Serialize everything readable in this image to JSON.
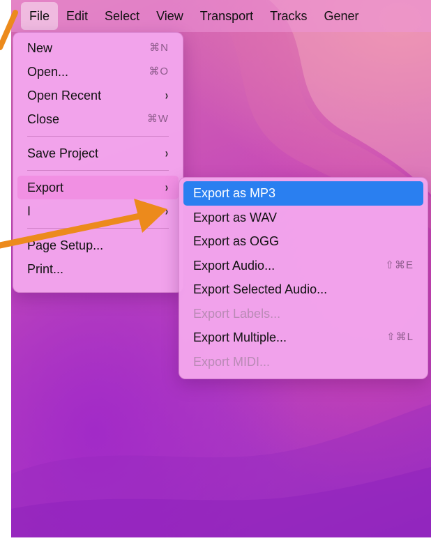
{
  "menubar": {
    "items": [
      {
        "label": "File",
        "active": true
      },
      {
        "label": "Edit"
      },
      {
        "label": "Select"
      },
      {
        "label": "View"
      },
      {
        "label": "Transport"
      },
      {
        "label": "Tracks"
      },
      {
        "label": "Gener"
      }
    ]
  },
  "file_menu": {
    "items": [
      {
        "label": "New",
        "shortcut": "⌘N"
      },
      {
        "label": "Open...",
        "shortcut": "⌘O"
      },
      {
        "label": "Open Recent",
        "submenu": "›"
      },
      {
        "label": "Close",
        "shortcut": "⌘W"
      },
      {
        "label": "Save Project",
        "submenu": "›"
      },
      {
        "label": "Export",
        "submenu": "›"
      },
      {
        "label": "I",
        "submenu": "›"
      },
      {
        "label": "Page Setup..."
      },
      {
        "label": "Print..."
      }
    ]
  },
  "export_menu": {
    "items": [
      {
        "label": "Export as MP3"
      },
      {
        "label": "Export as WAV"
      },
      {
        "label": "Export as OGG"
      },
      {
        "label": "Export Audio...",
        "shortcut": "⇧⌘E"
      },
      {
        "label": "Export Selected Audio..."
      },
      {
        "label": "Export Labels..."
      },
      {
        "label": "Export Multiple...",
        "shortcut": "⇧⌘L"
      },
      {
        "label": "Export MIDI..."
      }
    ]
  },
  "colors": {
    "selection": "#2a7ff0",
    "arrow": "#ec8a1c",
    "menu_bg": "#f3a5ec"
  }
}
